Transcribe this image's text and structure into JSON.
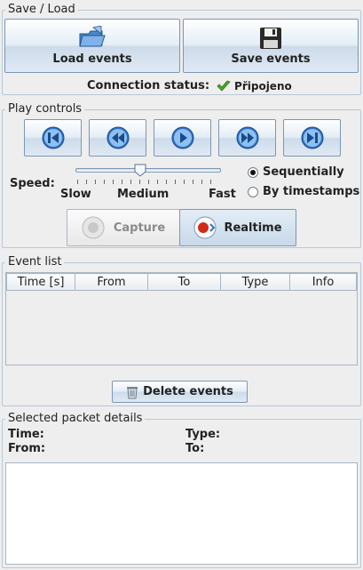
{
  "save_load": {
    "title": "Save / Load",
    "load_label": "Load events",
    "save_label": "Save events",
    "connection_label": "Connection status:",
    "connection_value": "Připojeno"
  },
  "play": {
    "title": "Play controls",
    "buttons": [
      "skip-to-start",
      "rewind",
      "play",
      "fast-forward",
      "skip-to-end"
    ],
    "speed_label": "Speed:",
    "speed_ticks": [
      "Slow",
      "Medium",
      "Fast"
    ],
    "speed_value": "Medium",
    "modes": [
      "Sequentially",
      "By timestamps"
    ],
    "selected_mode": "Sequentially",
    "capture_label": "Capture",
    "realtime_label": "Realtime"
  },
  "event_list": {
    "title": "Event list",
    "columns": [
      "Time [s]",
      "From",
      "To",
      "Type",
      "Info"
    ],
    "rows": [],
    "delete_label": "Delete events"
  },
  "details": {
    "title": "Selected packet details",
    "time_label": "Time:",
    "type_label": "Type:",
    "from_label": "From:",
    "to_label": "To:",
    "body": ""
  },
  "colors": {
    "button_border": "#7d97b3",
    "group_border": "#b8c8d8",
    "play_blue": "#2f74c9",
    "record_red": "#d12a1a",
    "check_green": "#48a82c"
  }
}
